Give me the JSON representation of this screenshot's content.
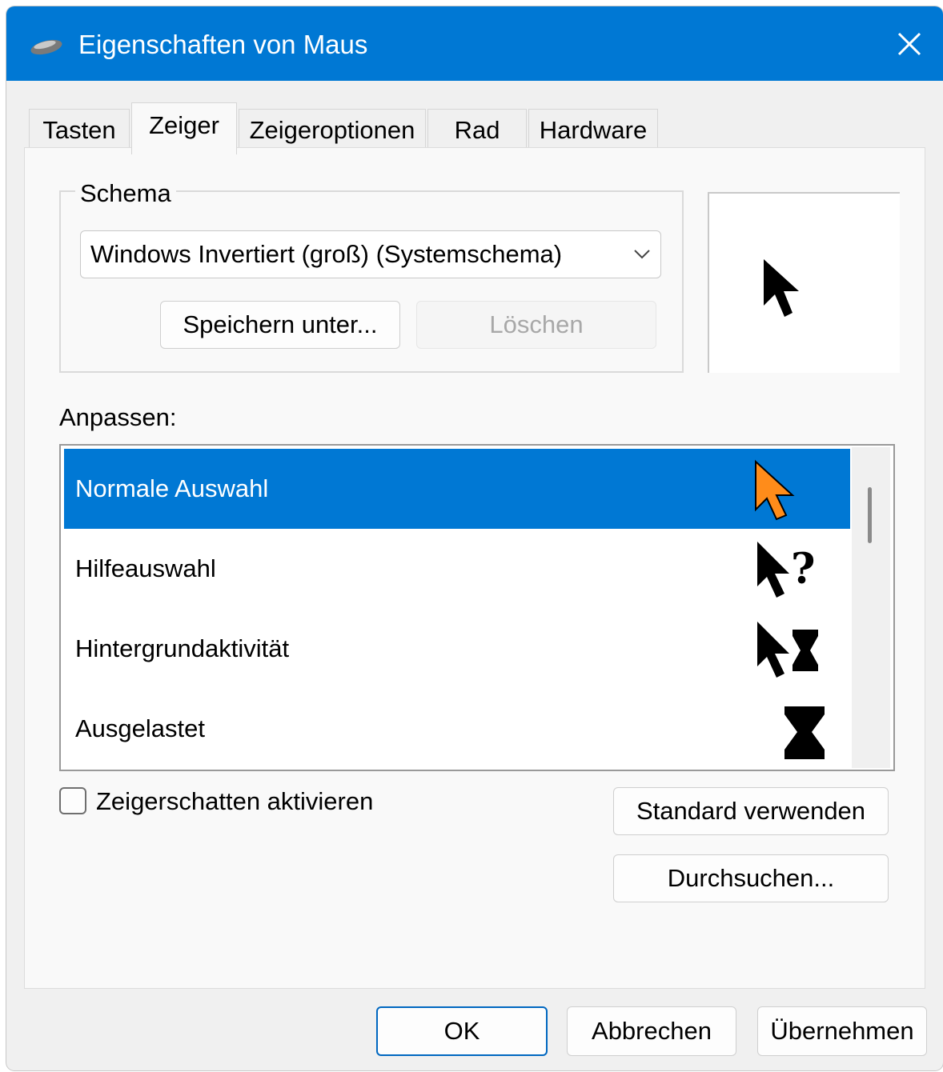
{
  "window": {
    "title": "Eigenschaften von Maus",
    "title_icon": "mouse-icon",
    "close_icon": "close-icon"
  },
  "tabs": [
    {
      "label": "Tasten",
      "active": false
    },
    {
      "label": "Zeiger",
      "active": true
    },
    {
      "label": "Zeigeroptionen",
      "active": false
    },
    {
      "label": "Rad",
      "active": false
    },
    {
      "label": "Hardware",
      "active": false
    }
  ],
  "schema": {
    "group_label": "Schema",
    "selected": "Windows Invertiert (groß) (Systemschema)",
    "save_label": "Speichern unter...",
    "delete_label": "Löschen",
    "preview_icon": "arrow-cursor-icon"
  },
  "customize": {
    "label": "Anpassen:",
    "items": [
      {
        "label": "Normale Auswahl",
        "icon": "orange-arrow-cursor-icon",
        "selected": true
      },
      {
        "label": "Hilfeauswahl",
        "icon": "help-cursor-icon",
        "selected": false
      },
      {
        "label": "Hintergrundaktivität",
        "icon": "working-cursor-icon",
        "selected": false
      },
      {
        "label": "Ausgelastet",
        "icon": "hourglass-icon",
        "selected": false
      }
    ]
  },
  "shadow": {
    "label": "Zeigerschatten aktivieren",
    "checked": false
  },
  "side_buttons": {
    "default_label": "Standard verwenden",
    "browse_label": "Durchsuchen..."
  },
  "footer": {
    "ok_label": "OK",
    "cancel_label": "Abbrechen",
    "apply_label": "Übernehmen"
  },
  "colors": {
    "titlebar": "#0078d4",
    "selection": "#0078d4",
    "selected_cursor": "#ff8c1a"
  }
}
